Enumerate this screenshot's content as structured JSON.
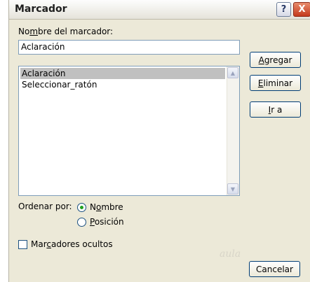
{
  "window": {
    "title": "Marcador"
  },
  "titlebar": {
    "help": "?",
    "close": "X"
  },
  "name_field": {
    "label_pre": "No",
    "label_access": "m",
    "label_post": "bre del marcador:",
    "value": "Aclaración"
  },
  "list": {
    "items": [
      {
        "label": "Aclaración",
        "selected": true
      },
      {
        "label": "Seleccionar_ratón",
        "selected": false
      }
    ]
  },
  "buttons": {
    "agregar": {
      "access": "A",
      "rest": "gregar"
    },
    "eliminar": {
      "access": "E",
      "rest": "liminar"
    },
    "ir_a": {
      "access": "I",
      "rest": "r a"
    },
    "cancelar": {
      "label": "Cancelar"
    }
  },
  "sort": {
    "label": "Ordenar por:",
    "nombre": {
      "pre": "N",
      "access": "o",
      "post": "mbre",
      "checked": true
    },
    "posicion": {
      "access": "P",
      "post": "osición",
      "checked": false
    }
  },
  "hidden_bookmarks": {
    "pre": "Mar",
    "access": "c",
    "post": "adores ocultos",
    "checked": false
  },
  "watermark": "aula",
  "colors": {
    "dialog_bg": "#ece9d8",
    "selection": "#c0c0c0",
    "radio_dot": "#21a121"
  }
}
